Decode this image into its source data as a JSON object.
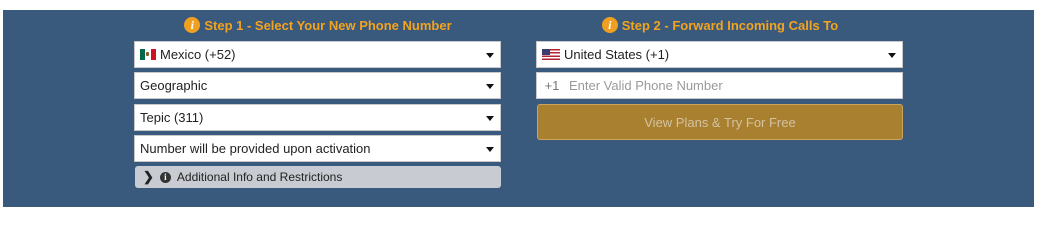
{
  "step1": {
    "title": "Step 1 - Select Your New Phone Number",
    "info_glyph": "i",
    "country": "Mexico (+52)",
    "country_flag_icon": "mexico-flag-icon",
    "number_type": "Geographic",
    "area": "Tepic (311)",
    "number_option": "Number will be provided upon activation",
    "additional_info": "Additional Info and Restrictions"
  },
  "step2": {
    "title": "Step 2 - Forward Incoming Calls To",
    "info_glyph": "i",
    "country": "United States (+1)",
    "country_flag_icon": "us-flag-icon",
    "prefix": "+1",
    "phone_value": "",
    "phone_placeholder": "Enter Valid Phone Number",
    "cta_label": "View Plans & Try For Free"
  },
  "colors": {
    "panel_bg": "#3a5a7d",
    "accent_orange": "#f2a31f",
    "cta_bg": "#a88030",
    "info_bar_bg": "#c8cbd1"
  }
}
